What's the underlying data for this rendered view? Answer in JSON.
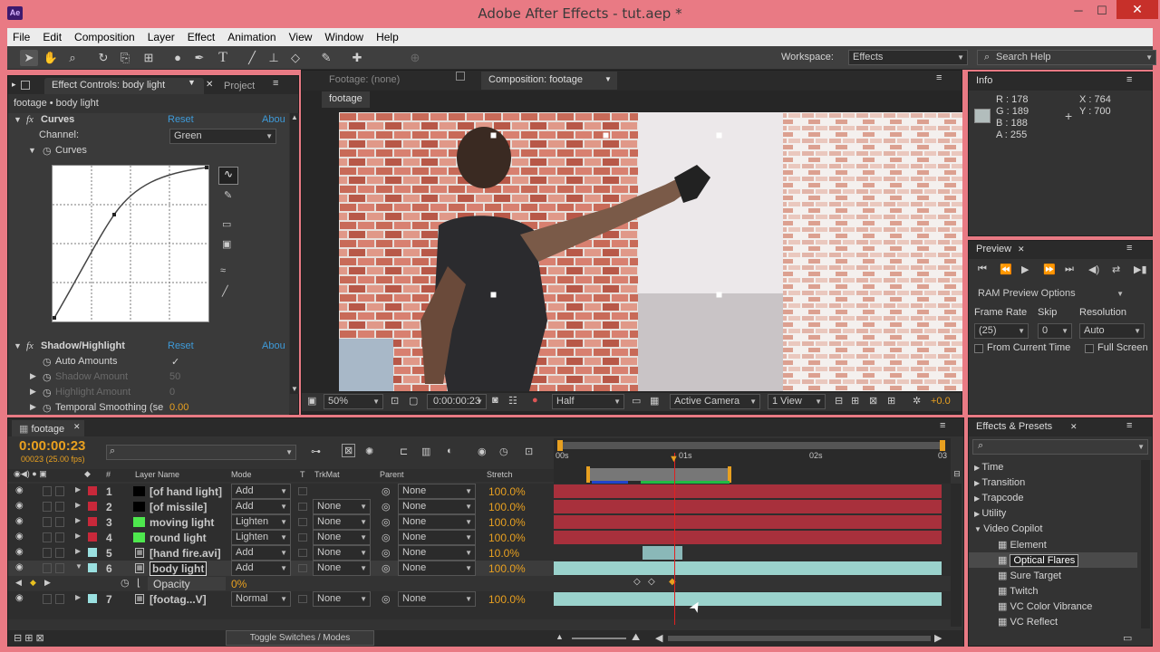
{
  "window": {
    "title": "Adobe After Effects - tut.aep *",
    "app_icon": "Ae",
    "minimize": "─",
    "maximize": "☐",
    "close": "✕"
  },
  "menu": [
    "File",
    "Edit",
    "Composition",
    "Layer",
    "Effect",
    "Animation",
    "View",
    "Window",
    "Help"
  ],
  "toolbar": {
    "workspace_label": "Workspace:",
    "workspace_value": "Effects",
    "search_placeholder": "Search Help"
  },
  "effect_controls": {
    "tab": "Effect Controls: body light",
    "project_tab": "Project",
    "path": "footage • body light",
    "curves": {
      "fx": "fx",
      "name": "Curves",
      "reset": "Reset",
      "about": "Abou",
      "channel_label": "Channel:",
      "channel_value": "Green",
      "sub": "Curves"
    },
    "shadow": {
      "fx": "fx",
      "name": "Shadow/Highlight",
      "reset": "Reset",
      "about": "Abou",
      "auto": "Auto Amounts",
      "auto_check": "✓",
      "shadow_amount": "Shadow Amount",
      "shadow_val": "50",
      "highlight_amount": "Highlight Amount",
      "highlight_val": "0",
      "temporal": "Temporal Smoothing (se",
      "temporal_val": "0.00"
    }
  },
  "composition": {
    "footage_tab": "Footage: (none)",
    "comp_tab": "Composition: footage",
    "sub_tab": "footage",
    "zoom": "50%",
    "timecode": "0:00:00:23",
    "resolution": "Half",
    "camera": "Active Camera",
    "views": "1 View",
    "exposure": "+0.0"
  },
  "info": {
    "tab": "Info",
    "r": "R : 178",
    "g": "G : 189",
    "b": "B : 188",
    "a": "A : 255",
    "x": "X : 764",
    "y": "Y : 700",
    "swatch": "#b2bdbc"
  },
  "preview": {
    "tab": "Preview",
    "ram": "RAM Preview Options",
    "frame_rate_label": "Frame Rate",
    "skip_label": "Skip",
    "resolution_label": "Resolution",
    "frame_rate": "(25)",
    "skip": "0",
    "resolution": "Auto",
    "from_current": "From Current Time",
    "full_screen": "Full Screen"
  },
  "effects_presets": {
    "tab": "Effects & Presets",
    "items": [
      "Time",
      "Transition",
      "Trapcode",
      "Utility"
    ],
    "open_folder": "Video Copilot",
    "children": [
      "Element",
      "Optical Flares",
      "Sure Target",
      "Twitch",
      "VC Color Vibrance",
      "VC Reflect"
    ],
    "selected": "Optical Flares"
  },
  "timeline": {
    "tab": "footage",
    "timecode": "0:00:00:23",
    "frames": "00023 (25.00 fps)",
    "headers": {
      "layer_name": "Layer Name",
      "mode": "Mode",
      "t": "T",
      "trkmat": "TrkMat",
      "parent": "Parent",
      "stretch": "Stretch",
      "num": "#"
    },
    "ruler": [
      "00s",
      "01s",
      "02s",
      "03"
    ],
    "layers": [
      {
        "num": "1",
        "name": "[of hand light]",
        "color": "#c8283a",
        "thumb": "#000000",
        "mode": "Add",
        "trkmat": "",
        "parent": "None",
        "stretch": "100.0%"
      },
      {
        "num": "2",
        "name": "[of missile]",
        "color": "#c8283a",
        "thumb": "#000000",
        "mode": "Add",
        "trkmat": "None",
        "parent": "None",
        "stretch": "100.0%"
      },
      {
        "num": "3",
        "name": "moving light",
        "color": "#c8283a",
        "thumb": "#4ee84e",
        "mode": "Lighten",
        "trkmat": "None",
        "parent": "None",
        "stretch": "100.0%"
      },
      {
        "num": "4",
        "name": "round light",
        "color": "#c8283a",
        "thumb": "#4ee84e",
        "mode": "Lighten",
        "trkmat": "None",
        "parent": "None",
        "stretch": "100.0%"
      },
      {
        "num": "5",
        "name": "[hand fire.avi]",
        "color": "#9ae0e0",
        "thumb": "file",
        "mode": "Add",
        "trkmat": "None",
        "parent": "None",
        "stretch": "10.0%"
      },
      {
        "num": "6",
        "name": "body light",
        "color": "#9ae0e0",
        "thumb": "file",
        "mode": "Add",
        "trkmat": "None",
        "parent": "None",
        "stretch": "100.0%"
      },
      {
        "num": "7",
        "name": "[footag...V]",
        "color": "#9ae0e0",
        "thumb": "file",
        "mode": "Normal",
        "trkmat": "None",
        "parent": "None",
        "stretch": "100.0%"
      }
    ],
    "opacity_label": "Opacity",
    "opacity_value": "0%",
    "toggle": "Toggle Switches / Modes"
  }
}
